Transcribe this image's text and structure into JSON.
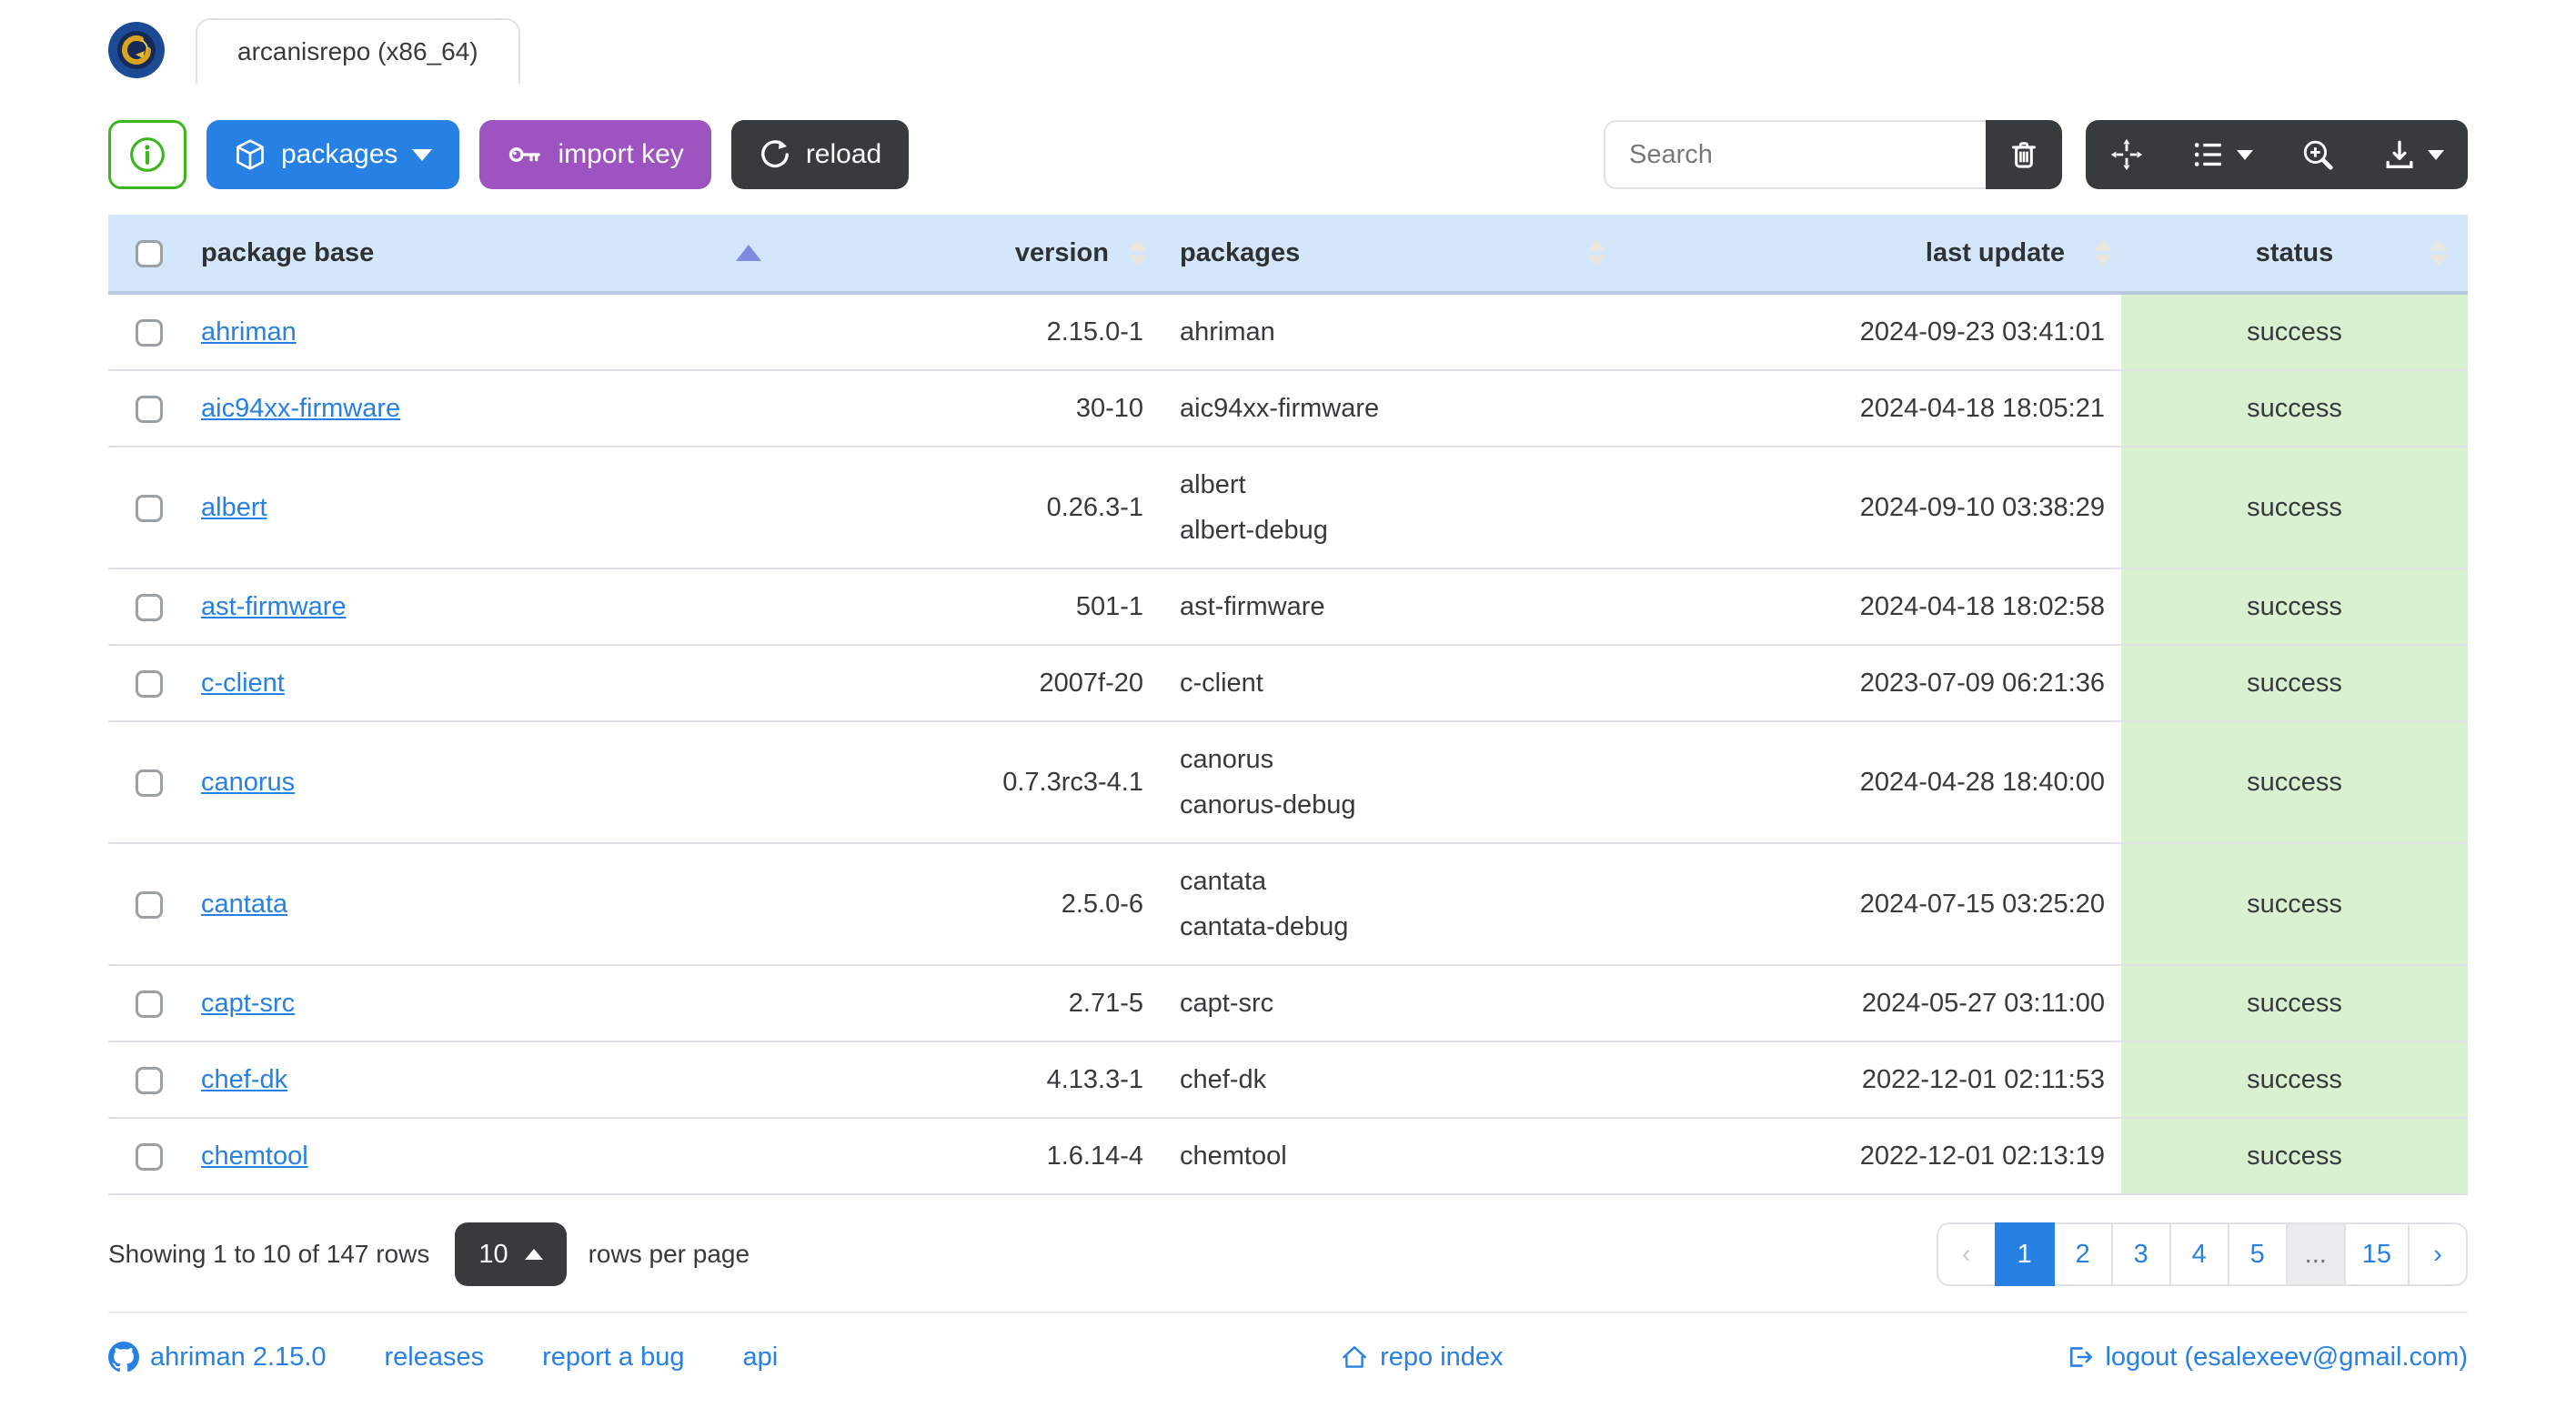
{
  "tab": {
    "title": "arcanisrepo (x86_64)"
  },
  "toolbar": {
    "packages_label": "packages",
    "import_key_label": "import key",
    "reload_label": "reload",
    "search_placeholder": "Search",
    "search_value": ""
  },
  "table": {
    "headers": {
      "package_base": "package base",
      "version": "version",
      "packages": "packages",
      "last_update": "last update",
      "status": "status"
    },
    "sort": {
      "column": "package base",
      "direction": "asc"
    },
    "rows": [
      {
        "base": "ahriman",
        "version": "2.15.0-1",
        "packages": [
          "ahriman"
        ],
        "last_update": "2024-09-23 03:41:01",
        "status": "success"
      },
      {
        "base": "aic94xx-firmware",
        "version": "30-10",
        "packages": [
          "aic94xx-firmware"
        ],
        "last_update": "2024-04-18 18:05:21",
        "status": "success"
      },
      {
        "base": "albert",
        "version": "0.26.3-1",
        "packages": [
          "albert",
          "albert-debug"
        ],
        "last_update": "2024-09-10 03:38:29",
        "status": "success"
      },
      {
        "base": "ast-firmware",
        "version": "501-1",
        "packages": [
          "ast-firmware"
        ],
        "last_update": "2024-04-18 18:02:58",
        "status": "success"
      },
      {
        "base": "c-client",
        "version": "2007f-20",
        "packages": [
          "c-client"
        ],
        "last_update": "2023-07-09 06:21:36",
        "status": "success"
      },
      {
        "base": "canorus",
        "version": "0.7.3rc3-4.1",
        "packages": [
          "canorus",
          "canorus-debug"
        ],
        "last_update": "2024-04-28 18:40:00",
        "status": "success"
      },
      {
        "base": "cantata",
        "version": "2.5.0-6",
        "packages": [
          "cantata",
          "cantata-debug"
        ],
        "last_update": "2024-07-15 03:25:20",
        "status": "success"
      },
      {
        "base": "capt-src",
        "version": "2.71-5",
        "packages": [
          "capt-src"
        ],
        "last_update": "2024-05-27 03:11:00",
        "status": "success"
      },
      {
        "base": "chef-dk",
        "version": "4.13.3-1",
        "packages": [
          "chef-dk"
        ],
        "last_update": "2022-12-01 02:11:53",
        "status": "success"
      },
      {
        "base": "chemtool",
        "version": "1.6.14-4",
        "packages": [
          "chemtool"
        ],
        "last_update": "2022-12-01 02:13:19",
        "status": "success"
      }
    ]
  },
  "pagination": {
    "summary": "Showing 1 to 10 of 147 rows",
    "page_size": "10",
    "rows_per_page_label": "rows per page",
    "prev": "‹",
    "next": "›",
    "pages": [
      "1",
      "2",
      "3",
      "4",
      "5",
      "...",
      "15"
    ],
    "active_page": "1"
  },
  "footer": {
    "version_link": "ahriman 2.15.0",
    "releases": "releases",
    "report_bug": "report a bug",
    "api": "api",
    "repo_index": "repo index",
    "logout": "logout (esalexeev@gmail.com)"
  },
  "colors": {
    "primary": "#2780e3",
    "purple": "#9d54c0",
    "dark": "#383b3d",
    "success_border": "#3cb521",
    "header_bg": "#d4e6f9",
    "status_bg": "#d9f0d1"
  }
}
